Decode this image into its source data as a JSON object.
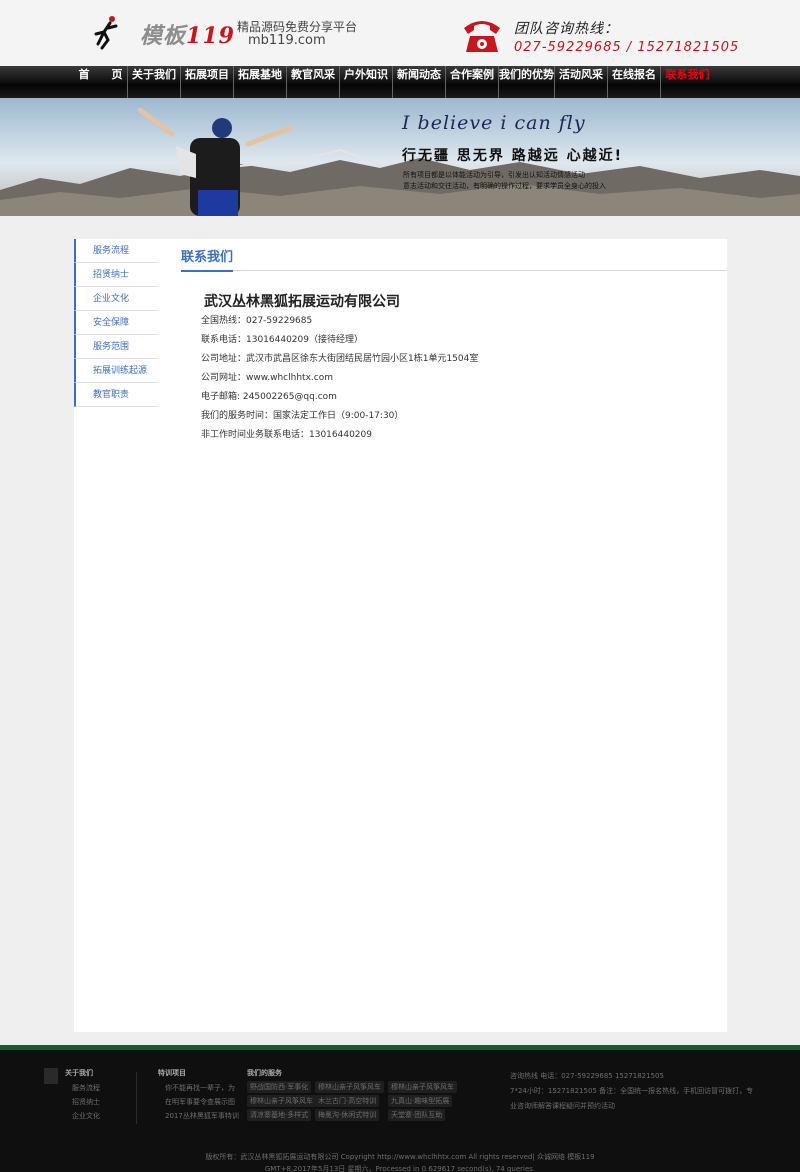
{
  "header": {
    "logo_text_a": "模板",
    "logo_text_b": "119",
    "slogan": "精品源码免费分享平台",
    "domain": "mb119.com",
    "hotline_title": "团队咨询热线：",
    "hotline_numbers": "027-59229685 / 15271821505"
  },
  "nav": {
    "items": [
      "首　　页",
      "关于我们",
      "拓展项目",
      "拓展基地",
      "教官风采",
      "户外知识",
      "新闻动态",
      "合作案例",
      "我们的优势",
      "活动风采",
      "在线报名",
      "联系我们"
    ],
    "active_index": 11
  },
  "banner": {
    "title": "I believe i can fly",
    "subtitle": "行无疆 思无界 路越远 心越近!",
    "line1": "所有项目都是以体能活动为引导，引发出认知活动情感活动",
    "line2": "意志活动和交往活动，有明确的操作过程，要求学员全身心的投入"
  },
  "sidebar": {
    "items": [
      "服务流程",
      "招贤纳士",
      "企业文化",
      "安全保障",
      "服务范围",
      "拓展训练起源",
      "教官职责"
    ]
  },
  "content": {
    "section_title": "联系我们",
    "company_name": "武汉丛林黑狐拓展运动有限公司",
    "lines": [
      "全国热线：027-59229685",
      "联系电话：13016440209（接待经理）",
      "公司地址：武汉市武昌区徐东大街团结民居竹园小区1栋1单元1504室",
      "公司网址：www.whclhhtx.com",
      "电子邮箱:  245002265@qq.com",
      "我们的服务时间：国家法定工作日（9:00-17:30）",
      "非工作时间业务联系电话：13016440209"
    ]
  },
  "footer": {
    "col1": {
      "title": "关于我们",
      "items": [
        "服务流程",
        "招贤纳士",
        "企业文化"
      ]
    },
    "col2": {
      "title": "特训项目",
      "items": [
        "你不能再找一辈子，为",
        "在明军事要令查展示图",
        "2017丛林黑狐军事特训"
      ]
    },
    "col3": {
      "title": "我们的服务",
      "tags": [
        "野战国防西·军事化",
        "穆林山亲子风筝风车",
        "穆林山亲子风筝风车",
        "穆林山亲子风筝风车",
        "木兰古门·高空特训",
        "九真山·趣味型拓展",
        "清凉寨基地·多样式",
        "梅冕沟·休闲式特训",
        "天堂寨·团队互助"
      ]
    },
    "contact_lines": [
      "咨询热线 电话：027-59229685 15271821505",
      "7*24小时：15271821505 备注：全国统一报名热线，手机回访冒可拨打，专",
      "业咨询师解答课程疑问并预约活动"
    ],
    "copyright1": "版权所有：武汉丛林黑狐拓展运动有限公司 Copyright http://www.whclhhtx.com All rights reserved|  众诚网络   模板119",
    "copyright2": "GMT+8,2017年5月13日 星期六，Processed in 0.629617 second(s), 74 queries."
  },
  "colors": {
    "accent": "#3c6fc1",
    "brand_red": "#c7161d",
    "nav_active": "#e60012",
    "footer_green": "#1a5c32"
  }
}
